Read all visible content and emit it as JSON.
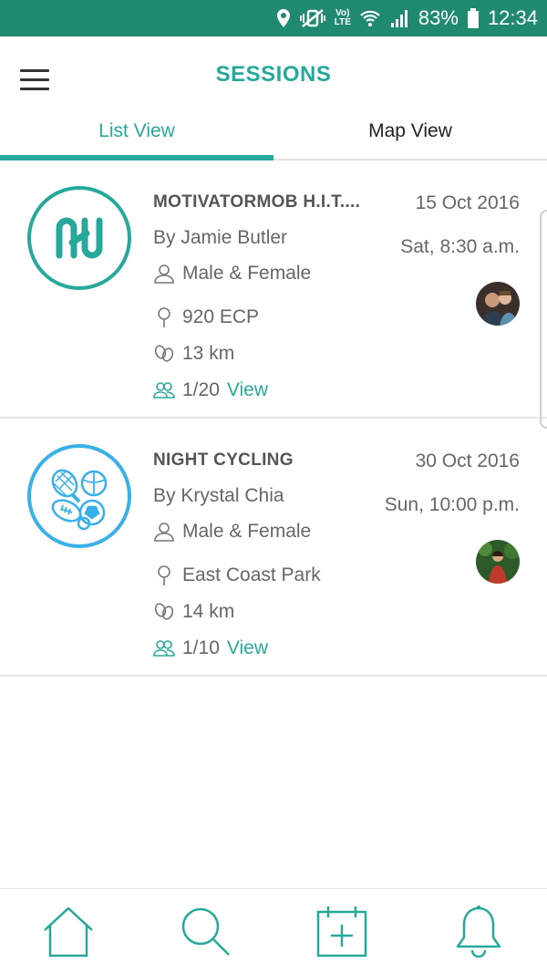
{
  "status_bar": {
    "battery": "83%",
    "time": "12:34",
    "network_top": "Vo)",
    "network_bottom": "LTE"
  },
  "header": {
    "title": "SESSIONS"
  },
  "tabs": [
    {
      "label": "List View",
      "active": true
    },
    {
      "label": "Map View",
      "active": false
    }
  ],
  "sessions": [
    {
      "title": "MOTIVATORMOB H.I.T....",
      "organizer": "By Jamie Butler",
      "gender": "Male & Female",
      "location": "920 ECP",
      "distance": "13 km",
      "participants": "1/20",
      "view_label": "View",
      "date": "15 Oct 2016",
      "time": "Sat, 8:30 a.m.",
      "logo_icon": "motivatormob-logo-icon",
      "accent": "#26a99b"
    },
    {
      "title": "NIGHT CYCLING",
      "organizer": "By Krystal Chia",
      "gender": "Male & Female",
      "location": "East Coast Park",
      "distance": "14 km",
      "participants": "1/10",
      "view_label": "View",
      "date": "30 Oct 2016",
      "time": "Sun, 10:00 p.m.",
      "logo_icon": "sports-balls-icon",
      "accent": "#3ab0e8"
    }
  ],
  "bottom_nav": [
    {
      "icon": "home-icon"
    },
    {
      "icon": "search-icon"
    },
    {
      "icon": "add-event-icon"
    },
    {
      "icon": "bell-icon"
    }
  ],
  "colors": {
    "primary": "#26a99b",
    "status_bar": "#1f8a70",
    "secondary": "#3ab0e8"
  }
}
